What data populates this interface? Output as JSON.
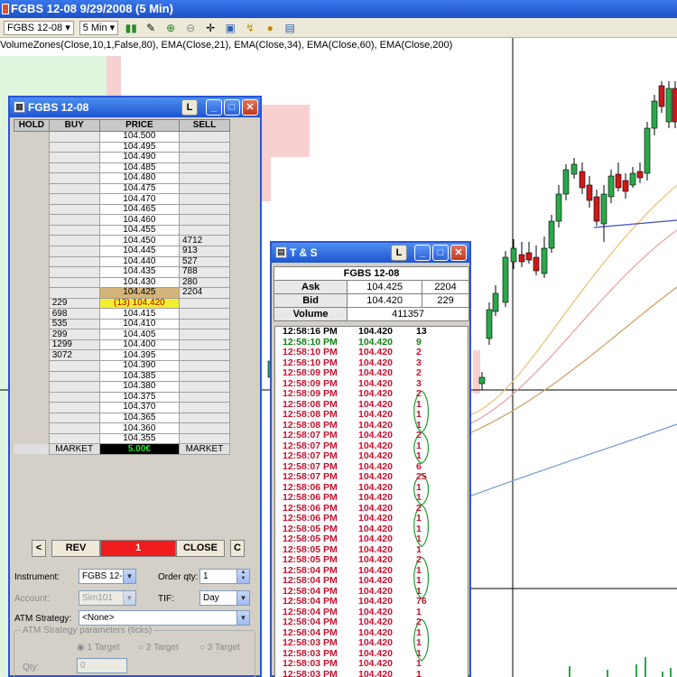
{
  "app": {
    "title": "FGBS 12-08  9/29/2008 (5 Min)",
    "toolbar": {
      "instrument": "FGBS 12-08",
      "interval": "5 Min"
    },
    "indicators": "VolumeZones(Close,10,1,False,80), EMA(Close,21), EMA(Close,34), EMA(Close,60), EMA(Close,200)"
  },
  "dom": {
    "title": "FGBS 12-08",
    "headers": {
      "hold": "HOLD",
      "buy": "BUY",
      "price": "PRICE",
      "sell": "SELL"
    },
    "rows": [
      {
        "buy": "",
        "price": "104.500",
        "sell": ""
      },
      {
        "buy": "",
        "price": "104.495",
        "sell": ""
      },
      {
        "buy": "",
        "price": "104.490",
        "sell": ""
      },
      {
        "buy": "",
        "price": "104.485",
        "sell": ""
      },
      {
        "buy": "",
        "price": "104.480",
        "sell": ""
      },
      {
        "buy": "",
        "price": "104.475",
        "sell": ""
      },
      {
        "buy": "",
        "price": "104.470",
        "sell": ""
      },
      {
        "buy": "",
        "price": "104.465",
        "sell": ""
      },
      {
        "buy": "",
        "price": "104.460",
        "sell": ""
      },
      {
        "buy": "",
        "price": "104.455",
        "sell": ""
      },
      {
        "buy": "",
        "price": "104.450",
        "sell": "4712"
      },
      {
        "buy": "",
        "price": "104.445",
        "sell": "913"
      },
      {
        "buy": "",
        "price": "104.440",
        "sell": "527"
      },
      {
        "buy": "",
        "price": "104.435",
        "sell": "788"
      },
      {
        "buy": "",
        "price": "104.430",
        "sell": "280"
      },
      {
        "buy": "",
        "price": "104.425",
        "sell": "2204",
        "state": "ask"
      },
      {
        "buy": "229",
        "price": "(13) 104.420",
        "sell": "",
        "state": "bid"
      },
      {
        "buy": "698",
        "price": "104.415",
        "sell": ""
      },
      {
        "buy": "535",
        "price": "104.410",
        "sell": ""
      },
      {
        "buy": "299",
        "price": "104.405",
        "sell": ""
      },
      {
        "buy": "1299",
        "price": "104.400",
        "sell": ""
      },
      {
        "buy": "3072",
        "price": "104.395",
        "sell": ""
      },
      {
        "buy": "",
        "price": "104.390",
        "sell": ""
      },
      {
        "buy": "",
        "price": "104.385",
        "sell": ""
      },
      {
        "buy": "",
        "price": "104.380",
        "sell": ""
      },
      {
        "buy": "",
        "price": "104.375",
        "sell": ""
      },
      {
        "buy": "",
        "price": "104.370",
        "sell": ""
      },
      {
        "buy": "",
        "price": "104.365",
        "sell": ""
      },
      {
        "buy": "",
        "price": "104.360",
        "sell": ""
      },
      {
        "buy": "",
        "price": "104.355",
        "sell": ""
      }
    ],
    "footer": {
      "market_buy": "MARKET",
      "pnl": "5.00€",
      "market_sell": "MARKET"
    },
    "controls": {
      "left": "<",
      "rev": "REV",
      "qty": "1",
      "close": "CLOSE",
      "right": "C"
    },
    "form": {
      "instrument_label": "Instrument:",
      "instrument_value": "FGBS 12-",
      "order_qty_label": "Order qty:",
      "order_qty_value": "1",
      "account_label": "Account:",
      "account_value": "Sim101",
      "tif_label": "TIF:",
      "tif_value": "Day",
      "atm_label": "ATM Strategy:",
      "atm_value": "<None>",
      "atm_params_label": "ATM Strategy parameters (ticks)",
      "target1": "1 Target",
      "target2": "2 Target",
      "target3": "3 Target",
      "qty_label": "Qty:",
      "qty_value": "0"
    }
  },
  "ts": {
    "title": "T & S",
    "instrument": "FGBS 12-08",
    "ask_label": "Ask",
    "ask_price": "104.425",
    "ask_size": "2204",
    "bid_label": "Bid",
    "bid_price": "104.420",
    "bid_size": "229",
    "volume_label": "Volume",
    "volume": "411357",
    "trades": [
      {
        "time": "12:58:16 PM",
        "price": "104.420",
        "vol": "13",
        "side": "n"
      },
      {
        "time": "12:58:10 PM",
        "price": "104.420",
        "vol": "9",
        "side": "g"
      },
      {
        "time": "12:58:10 PM",
        "price": "104.420",
        "vol": "2",
        "side": "r"
      },
      {
        "time": "12:58:10 PM",
        "price": "104.420",
        "vol": "3",
        "side": "r"
      },
      {
        "time": "12:58:09 PM",
        "price": "104.420",
        "vol": "2",
        "side": "r"
      },
      {
        "time": "12:58:09 PM",
        "price": "104.420",
        "vol": "3",
        "side": "r"
      },
      {
        "time": "12:58:09 PM",
        "price": "104.420",
        "vol": "2",
        "side": "r"
      },
      {
        "time": "12:58:08 PM",
        "price": "104.420",
        "vol": "1",
        "side": "r"
      },
      {
        "time": "12:58:08 PM",
        "price": "104.420",
        "vol": "1",
        "side": "r"
      },
      {
        "time": "12:58:08 PM",
        "price": "104.420",
        "vol": "1",
        "side": "r"
      },
      {
        "time": "12:58:07 PM",
        "price": "104.420",
        "vol": "2",
        "side": "r"
      },
      {
        "time": "12:58:07 PM",
        "price": "104.420",
        "vol": "1",
        "side": "r"
      },
      {
        "time": "12:58:07 PM",
        "price": "104.420",
        "vol": "1",
        "side": "r"
      },
      {
        "time": "12:58:07 PM",
        "price": "104.420",
        "vol": "6",
        "side": "r"
      },
      {
        "time": "12:58:07 PM",
        "price": "104.420",
        "vol": "25",
        "side": "r"
      },
      {
        "time": "12:58:06 PM",
        "price": "104.420",
        "vol": "1",
        "side": "r"
      },
      {
        "time": "12:58:06 PM",
        "price": "104.420",
        "vol": "1",
        "side": "r"
      },
      {
        "time": "12:58:06 PM",
        "price": "104.420",
        "vol": "2",
        "side": "r"
      },
      {
        "time": "12:58:06 PM",
        "price": "104.420",
        "vol": "1",
        "side": "r"
      },
      {
        "time": "12:58:05 PM",
        "price": "104.420",
        "vol": "1",
        "side": "r"
      },
      {
        "time": "12:58:05 PM",
        "price": "104.420",
        "vol": "1",
        "side": "r"
      },
      {
        "time": "12:58:05 PM",
        "price": "104.420",
        "vol": "1",
        "side": "r"
      },
      {
        "time": "12:58:05 PM",
        "price": "104.420",
        "vol": "2",
        "side": "r"
      },
      {
        "time": "12:58:04 PM",
        "price": "104.420",
        "vol": "1",
        "side": "r"
      },
      {
        "time": "12:58:04 PM",
        "price": "104.420",
        "vol": "1",
        "side": "r"
      },
      {
        "time": "12:58:04 PM",
        "price": "104.420",
        "vol": "1",
        "side": "r"
      },
      {
        "time": "12:58:04 PM",
        "price": "104.420",
        "vol": "76",
        "side": "r"
      },
      {
        "time": "12:58:04 PM",
        "price": "104.420",
        "vol": "1",
        "side": "r"
      },
      {
        "time": "12:58:04 PM",
        "price": "104.420",
        "vol": "2",
        "side": "r"
      },
      {
        "time": "12:58:04 PM",
        "price": "104.420",
        "vol": "1",
        "side": "r"
      },
      {
        "time": "12:58:03 PM",
        "price": "104.420",
        "vol": "1",
        "side": "r"
      },
      {
        "time": "12:58:03 PM",
        "price": "104.420",
        "vol": "1",
        "side": "r"
      },
      {
        "time": "12:58:03 PM",
        "price": "104.420",
        "vol": "1",
        "side": "r"
      },
      {
        "time": "12:58:03 PM",
        "price": "104.420",
        "vol": "1",
        "side": "r"
      }
    ]
  },
  "colors": {
    "up": "#2aa84a",
    "down": "#d01818",
    "trade_up": "#108010",
    "trade_down": "#c8102e",
    "ask_cell": "#d4b47a",
    "bid_cell": "#f4ee30"
  }
}
